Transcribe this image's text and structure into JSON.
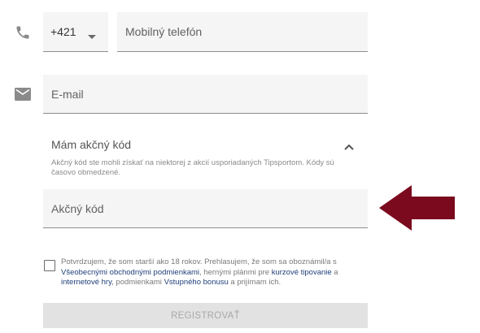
{
  "phone": {
    "prefix_value": "+421",
    "placeholder": "Mobilný telefón"
  },
  "email": {
    "placeholder": "E-mail"
  },
  "promo": {
    "toggle_label": "Mám akčný kód",
    "hint": "Akčný kód ste mohli získať na niektorej z akcií usporiadaných Tipsportom. Kódy sú časovo obmedzené.",
    "code_placeholder": "Akčný kód"
  },
  "consent": {
    "part1": "Potvrdzujem, že som starší ako 18 rokov. Prehlasujem, že som sa oboznámil/a s ",
    "link_terms": "Všeobecnými obchodnými podmienkami",
    "part2": ", hernými plánmi pre ",
    "link_odds": "kurzové tipovanie",
    "part3": " a ",
    "link_games": "internetové hry",
    "part4": ", podmienkami ",
    "link_bonus": "Vstupného bonusu",
    "part5": " a prijímam ich."
  },
  "register": {
    "label": "REGISTROVAŤ"
  },
  "colors": {
    "arrow": "#7b0a1e",
    "link": "#1f3f7a",
    "field_bg": "#f5f5f5",
    "button_disabled_bg": "#e2e2e2"
  },
  "icons": {
    "phone": "phone-icon",
    "email": "email-icon",
    "prefix_dropdown": "caret-down-icon",
    "promo_toggle": "chevron-up-icon",
    "annotation": "left-arrow-icon"
  }
}
